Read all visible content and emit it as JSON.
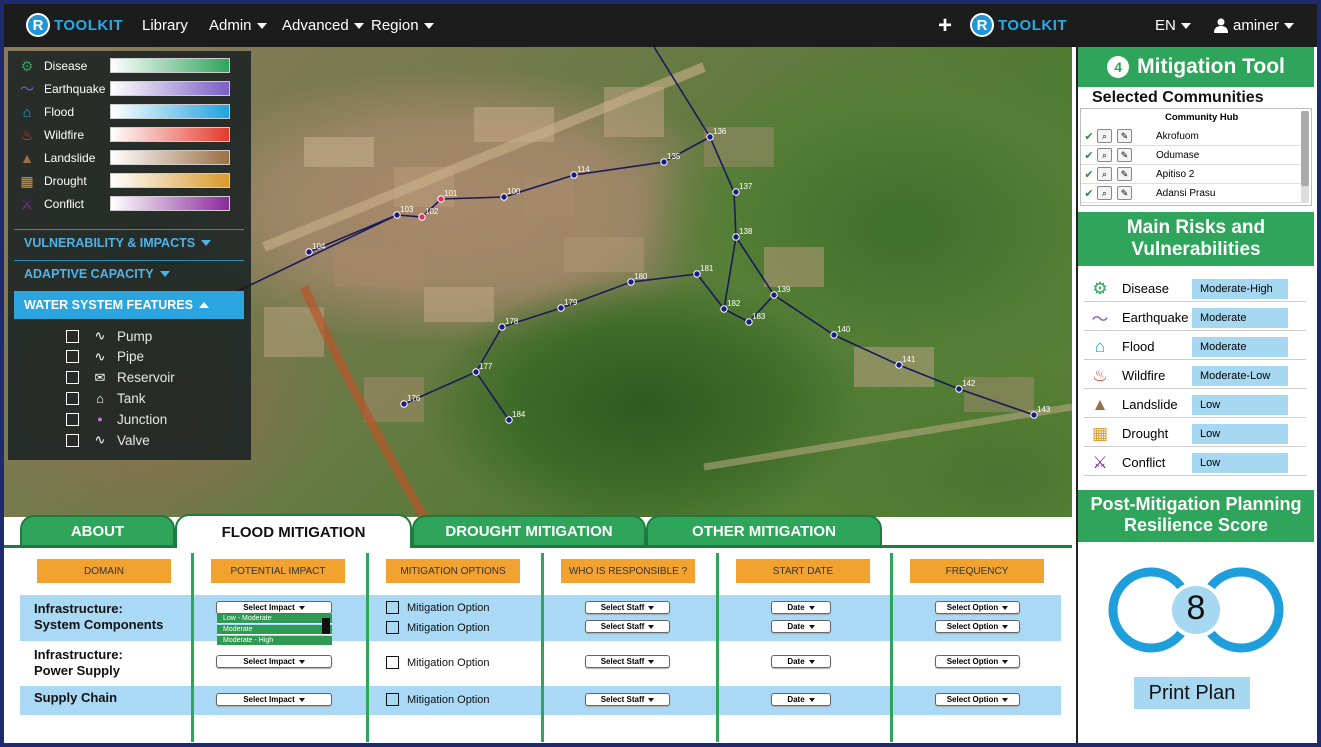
{
  "topbar": {
    "brand_letter": "R",
    "brand_text": "TOOLKIT",
    "nav": {
      "library": "Library",
      "admin": "Admin",
      "advanced": "Advanced",
      "region": "Region"
    },
    "plus": "+",
    "lang": "EN",
    "user": "aminer"
  },
  "legend": {
    "hazards": [
      {
        "label": "Disease",
        "icon": "virus-icon",
        "color": "#2ea55a"
      },
      {
        "label": "Earthquake",
        "icon": "earthquake-icon",
        "color": "#7b5ec4"
      },
      {
        "label": "Flood",
        "icon": "flood-icon",
        "color": "#1fa3e0"
      },
      {
        "label": "Wildfire",
        "icon": "fire-icon",
        "color": "#e43b2c"
      },
      {
        "label": "Landslide",
        "icon": "landslide-icon",
        "color": "#9b7046"
      },
      {
        "label": "Drought",
        "icon": "drought-icon",
        "color": "#d89a2a"
      },
      {
        "label": "Conflict",
        "icon": "conflict-icon",
        "color": "#8a2a9a"
      }
    ],
    "sections": {
      "vulnerability": "VULNERABILITY & IMPACTS",
      "adaptive": "ADAPTIVE CAPACITY",
      "water": "WATER SYSTEM FEATURES"
    },
    "features": [
      "Pump",
      "Pipe",
      "Reservoir",
      "Tank",
      "Junction",
      "Valve"
    ]
  },
  "map": {
    "nodes": [
      "136",
      "135",
      "114",
      "100",
      "101",
      "102",
      "103",
      "104",
      "137",
      "138",
      "181",
      "180",
      "179",
      "178",
      "177",
      "176",
      "184",
      "182",
      "183",
      "139",
      "140",
      "141",
      "142",
      "143"
    ]
  },
  "tabs": {
    "about": "ABOUT",
    "flood": "FLOOD MITIGATION",
    "drought": "DROUGHT MITIGATION",
    "other": "OTHER MITIGATION"
  },
  "table": {
    "headers": [
      "DOMAIN",
      "POTENTIAL IMPACT",
      "MITIGATION OPTIONS",
      "WHO IS RESPONSIBLE ?",
      "START DATE",
      "FREQUENCY"
    ],
    "rows": [
      {
        "domain_line1": "Infrastructure:",
        "domain_line2": "System Components"
      },
      {
        "domain_line1": "Infrastructure:",
        "domain_line2": "Power Supply"
      },
      {
        "domain_line1": "Supply Chain",
        "domain_line2": ""
      }
    ],
    "select_impact": "Select Impact",
    "impact_options": [
      "Low - Moderate",
      "Moderate",
      "Moderate - High"
    ],
    "mitigation_option": "Mitigation Option",
    "select_staff": "Select Staff",
    "date": "Date",
    "select_option": "Select Option"
  },
  "panel": {
    "step": "4",
    "title": "Mitigation Tool",
    "selected_communities": "Selected Communities",
    "community_header": "Community Hub",
    "communities": [
      "Akrofuom",
      "Odumase",
      "Apitiso 2",
      "Adansi Prasu"
    ],
    "risks_title_line1": "Main Risks and",
    "risks_title_line2": "Vulnerabilities",
    "risks": [
      {
        "name": "Disease",
        "value": "Moderate-High",
        "icon": "virus-icon"
      },
      {
        "name": "Earthquake",
        "value": "Moderate",
        "icon": "earthquake-icon"
      },
      {
        "name": "Flood",
        "value": "Moderate",
        "icon": "flood-icon"
      },
      {
        "name": "Wildfire",
        "value": "Moderate-Low",
        "icon": "fire-icon"
      },
      {
        "name": "Landslide",
        "value": "Low",
        "icon": "landslide-icon"
      },
      {
        "name": "Drought",
        "value": "Low",
        "icon": "drought-icon"
      },
      {
        "name": "Conflict",
        "value": "Low",
        "icon": "conflict-icon"
      }
    ],
    "score_title_line1": "Post-Mitigation Planning",
    "score_title_line2": "Resilience Score",
    "score": "8",
    "print": "Print Plan"
  },
  "colors": {
    "green": "#2ea55a",
    "blue": "#2aa5e0",
    "orange": "#f2a22f",
    "band": "#a9d9f4"
  }
}
